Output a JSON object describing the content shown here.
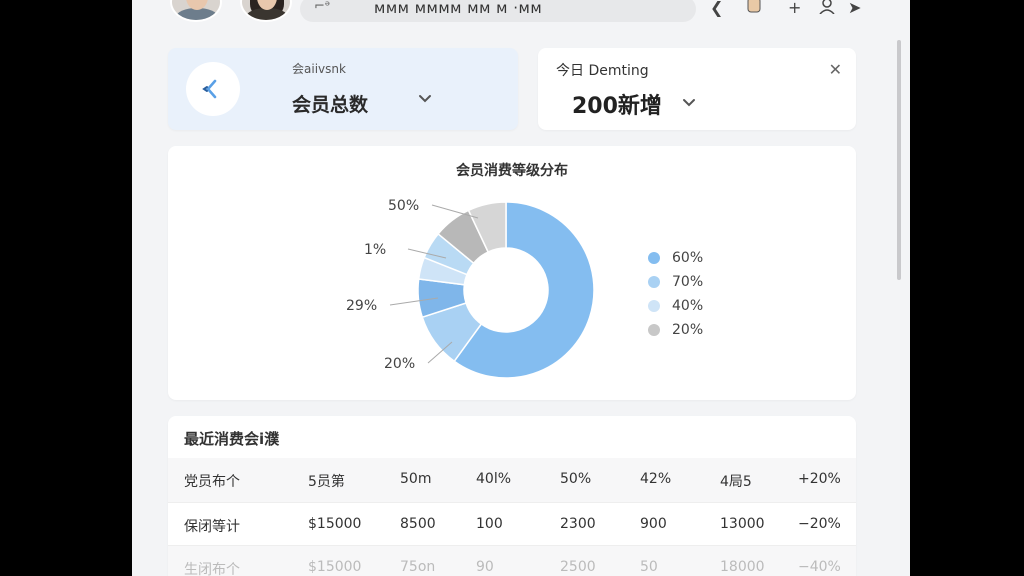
{
  "header": {
    "search_prefix": "⌐ᵊ",
    "search_text": "ᴍᴍᴍ ᴍᴍᴍᴍ ᴍᴍ ᴍ ·ᴍᴍ"
  },
  "cards": {
    "total": {
      "caption": "会aiivsnk",
      "value": "会员总数"
    },
    "today": {
      "caption": "今日 Demting",
      "value": "200新增"
    }
  },
  "chart_data": {
    "type": "pie",
    "title": "会员消费等级分布",
    "slices": [
      {
        "value": 60,
        "color": "#84bdf0"
      },
      {
        "value": 10,
        "color": "#a9d1f3"
      },
      {
        "value": 7,
        "color": "#7fb6ea"
      },
      {
        "value": 4,
        "color": "#cfe4f7"
      },
      {
        "value": 5,
        "color": "#b9daf4"
      },
      {
        "value": 7,
        "color": "#b8b8b8"
      },
      {
        "value": 7,
        "color": "#d6d6d6"
      }
    ],
    "outer_labels": [
      "50%",
      "1%",
      "29%",
      "20%"
    ],
    "legend": [
      {
        "label": "60%",
        "color": "#84bdf0"
      },
      {
        "label": "70%",
        "color": "#a9d1f3"
      },
      {
        "label": "40%",
        "color": "#cfe4f7"
      },
      {
        "label": "20%",
        "color": "#c8c8c8"
      }
    ]
  },
  "table": {
    "title": "最近消费会i濮",
    "rows": [
      [
        "党员布个",
        "5员第",
        "50m",
        "40l%",
        "50%",
        "42%",
        "4局5",
        "+20%"
      ],
      [
        "保闭等计",
        "$15000",
        "8500",
        "100",
        "2300",
        "900",
        "13000",
        "−20%"
      ],
      [
        "生闭布个",
        "$15000",
        "75on",
        "90",
        "2500",
        "50",
        "18000",
        "−40%"
      ]
    ]
  }
}
